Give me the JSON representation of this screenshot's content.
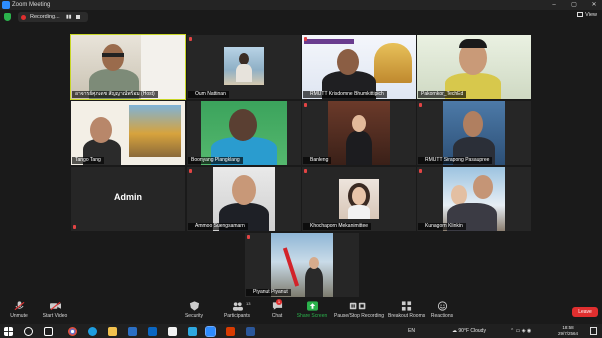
{
  "window": {
    "title": "Zoom Meeting",
    "controls": [
      "–",
      "▢",
      "✕"
    ]
  },
  "recording": {
    "label": "Recording...",
    "pause": "▮▮"
  },
  "view": {
    "label": "View"
  },
  "tiles": [
    {
      "id": "host",
      "name": "อาจารย์ศุภเดช สัญญาณ์พร้อม (Host)"
    },
    {
      "id": "oum",
      "name": "Oum Nattinan"
    },
    {
      "id": "kriso",
      "name": "RMUTT Krisdomne Bhumkittipich"
    },
    {
      "id": "pakornkor",
      "name": "Pakornkor_TechEd"
    },
    {
      "id": "tango",
      "name": "Tango Tang"
    },
    {
      "id": "boonyang",
      "name": "Boonyang Plangklang"
    },
    {
      "id": "banleng",
      "name": "Banleng"
    },
    {
      "id": "sirapong",
      "name": "RMUTT Sirapong Pasaupree"
    },
    {
      "id": "admin",
      "name": "",
      "placeholder_text": "Admin"
    },
    {
      "id": "ammoo",
      "name": "Ammoo Suengsamarn"
    },
    {
      "id": "khochaporn",
      "name": "Khochaporn Mekanimittee"
    },
    {
      "id": "kunagorn",
      "name": "Kunagorn Klinkin"
    },
    {
      "id": "piyanut",
      "name": "Piyanut Piyanut"
    }
  ],
  "toolbar": {
    "unmute": "Unmute",
    "start_video": "Start Video",
    "security": "Security",
    "participants": "Participants",
    "participants_count": "13",
    "chat": "Chat",
    "chat_badge": "1",
    "share_screen": "Share Screen",
    "pause_stop_recording": "Pause/Stop Recording",
    "breakout_rooms": "Breakout Rooms",
    "reactions": "Reactions",
    "leave": "Leave"
  },
  "taskbar": {
    "language": "EN",
    "weather": "90°F  Cloudy",
    "time": "18:58",
    "date": "29/7/2564"
  },
  "colors": {
    "active_speaker": "#c8d626",
    "leave": "#e02f2f",
    "share_screen": "#2bb24c",
    "zoom_blue": "#2d8cff"
  }
}
